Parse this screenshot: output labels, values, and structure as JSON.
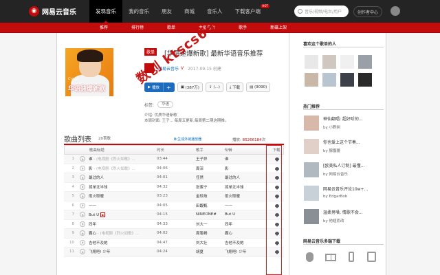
{
  "header": {
    "logo_text": "网易云音乐",
    "nav": [
      "发现音乐",
      "我的音乐",
      "朋友",
      "商城",
      "音乐人",
      "下载客户端"
    ],
    "hot_badge": "HOT",
    "search_placeholder": "音乐/视频/电台/用户",
    "creator_center": "创作者中心"
  },
  "subnav": [
    "推荐",
    "排行榜",
    "歌单",
    "主播电台",
    "歌手",
    "新碟上架"
  ],
  "playlist": {
    "cover_cpop": "C-pop",
    "cover_title": "华语速爆新歌",
    "tag": "歌单",
    "title": "[华语速爆新歌] 最新华语音乐推荐",
    "creator": "网易云音乐",
    "verified": "V",
    "date": "2017-09-15 创建",
    "buttons": {
      "play": "播放",
      "add": "+",
      "collect": "(387万)",
      "share": "(...)",
      "download": "下载",
      "comment": "(9090)"
    },
    "tags_label": "标签:",
    "tag_item": "华语",
    "desc1": "介绍: 优质华语新歌",
    "desc2": "本周封面: 王子... 每周五更新,每周第二期这期推。",
    "watermark": "数创 ktscs66"
  },
  "songlist": {
    "heading": "歌曲列表",
    "count": "20首歌",
    "link": "生成外链播放器",
    "plays_label": "播放: ",
    "plays": "85266184",
    "plays_unit": "次",
    "columns": [
      "",
      "歌曲标题",
      "时长",
      "歌手",
      "专辑",
      "下载"
    ],
    "rows": [
      {
        "idx": "1",
        "title": "谁",
        "sub": " - (电视剧《烈火如歌》...",
        "dur": "03:44",
        "artist": "王子异",
        "album": "谁",
        "mv": false
      },
      {
        "idx": "2",
        "title": "影",
        "sub": " - (电视剧《烈火如歌》...",
        "dur": "04:06",
        "artist": "周深",
        "album": "影",
        "mv": false
      },
      {
        "idx": "3",
        "title": "最过的人",
        "sub": "",
        "dur": "04:01",
        "artist": "任然",
        "album": "最过的人",
        "mv": false
      },
      {
        "idx": "4",
        "title": "孤单北半球",
        "sub": "",
        "dur": "04:32",
        "artist": "张紫宁",
        "album": "孤单北半球",
        "mv": false
      },
      {
        "idx": "5",
        "title": "雨火取暖",
        "sub": "",
        "dur": "03:23",
        "artist": "金玟岐",
        "album": "雨火取暖",
        "mv": false
      },
      {
        "idx": "6",
        "title": "一一",
        "sub": "",
        "dur": "04:05",
        "artist": "田馥甄",
        "album": "一一",
        "mv": false
      },
      {
        "idx": "7",
        "title": "But U",
        "sub": "",
        "dur": "04:15",
        "artist": "NINEONE#",
        "album": "But U",
        "mv": true
      },
      {
        "idx": "8",
        "title": "同年",
        "sub": "",
        "dur": "04:33",
        "artist": "刘大一",
        "album": "同年",
        "mv": false
      },
      {
        "idx": "9",
        "title": "霸心",
        "sub": " - (电视剧《烈火如歌》...",
        "dur": "04:02",
        "artist": "周笔畅",
        "album": "霸心",
        "mv": false
      },
      {
        "idx": "10",
        "title": "吉他不及她",
        "sub": "",
        "dur": "04:47",
        "artist": "刘大壮",
        "album": "吉他不及她",
        "mv": false
      },
      {
        "idx": "11",
        "title": "飞翔吧! 少年",
        "sub": "",
        "dur": "04:24",
        "artist": "胡夏",
        "album": "飞翔吧! 少年",
        "mv": false
      }
    ]
  },
  "aside": {
    "likers_title": "喜欢这个歌单的人",
    "recommend_title": "热门推荐",
    "recommend": [
      {
        "title": "神仙翻唱: 超好听的...",
        "by": "by ",
        "user": "小野树"
      },
      {
        "title": "你也爱上这个节奏...",
        "by": "by ",
        "user": "朦朧薔"
      },
      {
        "title": "[欧美私人订制] 最懂...",
        "by": "by ",
        "user": "网易云音乐"
      },
      {
        "title": "网易云音乐评论10w+...",
        "by": "by ",
        "user": "EdgarBob"
      },
      {
        "title": "温柔男嗓, 情歌不会...",
        "by": "by ",
        "user": "他翅而改"
      }
    ],
    "download_title": "网易云音乐多端下载"
  },
  "colors": {
    "brand": "#c20c0c",
    "link": "#0c73c2",
    "topbar": "#242424"
  }
}
